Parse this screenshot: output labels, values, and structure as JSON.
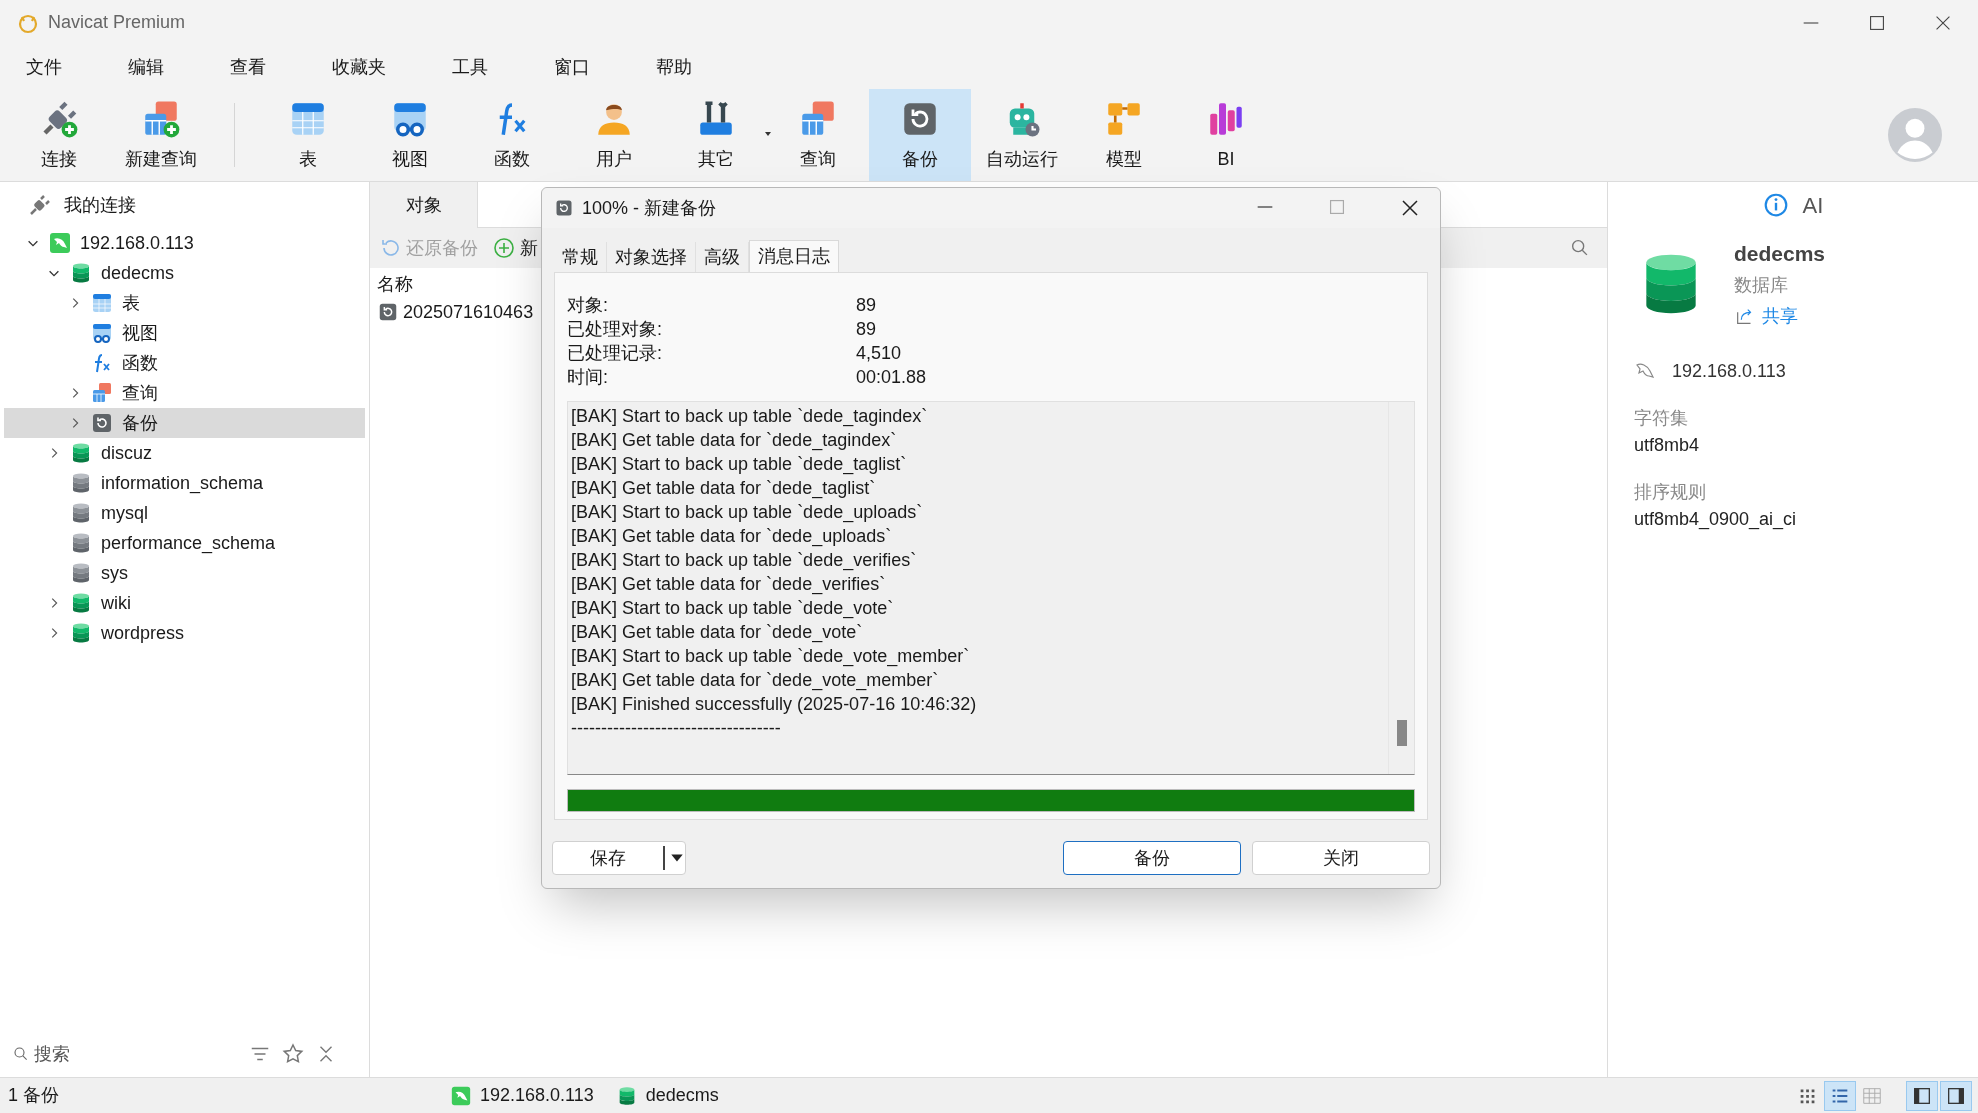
{
  "window": {
    "title": "Navicat Premium"
  },
  "menu": [
    "文件",
    "编辑",
    "查看",
    "收藏夹",
    "工具",
    "窗口",
    "帮助"
  ],
  "toolbar": [
    {
      "kind": "connect",
      "label": "连接",
      "selected": false,
      "dropdown": false
    },
    {
      "kind": "new_query",
      "label": "新建查询",
      "selected": false,
      "dropdown": false
    },
    {
      "kind": "table",
      "label": "表",
      "selected": false,
      "dropdown": false
    },
    {
      "kind": "view",
      "label": "视图",
      "selected": false,
      "dropdown": false
    },
    {
      "kind": "function",
      "label": "函数",
      "selected": false,
      "dropdown": false
    },
    {
      "kind": "user",
      "label": "用户",
      "selected": false,
      "dropdown": false
    },
    {
      "kind": "other",
      "label": "其它",
      "selected": false,
      "dropdown": true
    },
    {
      "kind": "query",
      "label": "查询",
      "selected": false,
      "dropdown": false
    },
    {
      "kind": "backup",
      "label": "备份",
      "selected": true,
      "dropdown": false
    },
    {
      "kind": "automation",
      "label": "自动运行",
      "selected": false,
      "dropdown": false
    },
    {
      "kind": "model",
      "label": "模型",
      "selected": false,
      "dropdown": false
    },
    {
      "kind": "bi",
      "label": "BI",
      "selected": false,
      "dropdown": false
    }
  ],
  "sidebar": {
    "header": "我的连接",
    "tree": [
      {
        "kind": "connection",
        "label": "192.168.0.113",
        "expandable": true,
        "expanded": true,
        "selected": false,
        "children": [
          {
            "kind": "db_open",
            "label": "dedecms",
            "expandable": true,
            "expanded": true,
            "selected": false,
            "children": [
              {
                "kind": "table",
                "label": "表",
                "expandable": true,
                "expanded": false,
                "selected": false
              },
              {
                "kind": "view",
                "label": "视图",
                "expandable": false,
                "expanded": false,
                "selected": false
              },
              {
                "kind": "function",
                "label": "函数",
                "expandable": false,
                "expanded": false,
                "selected": false
              },
              {
                "kind": "query",
                "label": "查询",
                "expandable": true,
                "expanded": false,
                "selected": false
              },
              {
                "kind": "backup",
                "label": "备份",
                "expandable": true,
                "expanded": false,
                "selected": true
              }
            ]
          },
          {
            "kind": "db_open",
            "label": "discuz",
            "expandable": true,
            "expanded": false,
            "selected": false
          },
          {
            "kind": "db_closed",
            "label": "information_schema",
            "expandable": false,
            "expanded": false,
            "selected": false
          },
          {
            "kind": "db_closed",
            "label": "mysql",
            "expandable": false,
            "expanded": false,
            "selected": false
          },
          {
            "kind": "db_closed",
            "label": "performance_schema",
            "expandable": false,
            "expanded": false,
            "selected": false
          },
          {
            "kind": "db_closed",
            "label": "sys",
            "expandable": false,
            "expanded": false,
            "selected": false
          },
          {
            "kind": "db_open",
            "label": "wiki",
            "expandable": true,
            "expanded": false,
            "selected": false
          },
          {
            "kind": "db_open",
            "label": "wordpress",
            "expandable": true,
            "expanded": false,
            "selected": false
          }
        ]
      }
    ],
    "search": {
      "placeholder": "搜索"
    }
  },
  "objects": {
    "tabs": [
      {
        "label": "对象",
        "selected": true
      }
    ],
    "actions": [
      {
        "kind": "restore",
        "label": "还原备份",
        "disabled": true
      },
      {
        "kind": "new",
        "label": "新",
        "disabled": false
      }
    ],
    "columns": [
      "名称"
    ],
    "rows": [
      "2025071610463"
    ]
  },
  "info": {
    "tabs": [
      {
        "kind": "info",
        "selected": true
      },
      {
        "kind": "ai",
        "label": "AI",
        "selected": false
      }
    ],
    "name": "dedecms",
    "type": "数据库",
    "share": "共享",
    "connection": "192.168.0.113",
    "fields": [
      {
        "label": "字符集",
        "value": "utf8mb4"
      },
      {
        "label": "排序规则",
        "value": "utf8mb4_0900_ai_ci"
      }
    ]
  },
  "dialog": {
    "title": "100% - 新建备份",
    "tabs": [
      {
        "label": "常规",
        "selected": false
      },
      {
        "label": "对象选择",
        "selected": false
      },
      {
        "label": "高级",
        "selected": false
      },
      {
        "label": "消息日志",
        "selected": true
      }
    ],
    "stats": [
      {
        "label": "对象:",
        "value": "89"
      },
      {
        "label": "已处理对象:",
        "value": "89"
      },
      {
        "label": "已处理记录:",
        "value": "4,510"
      },
      {
        "label": "时间:",
        "value": "00:01.88"
      }
    ],
    "log": [
      "[BAK] Start to back up table `dede_tagindex`",
      "[BAK] Get table data for `dede_tagindex`",
      "[BAK] Start to back up table `dede_taglist`",
      "[BAK] Get table data for `dede_taglist`",
      "[BAK] Start to back up table `dede_uploads`",
      "[BAK] Get table data for `dede_uploads`",
      "[BAK] Start to back up table `dede_verifies`",
      "[BAK] Get table data for `dede_verifies`",
      "[BAK] Start to back up table `dede_vote`",
      "[BAK] Get table data for `dede_vote`",
      "[BAK] Start to back up table `dede_vote_member`",
      "[BAK] Get table data for `dede_vote_member`",
      "[BAK] Finished successfully (2025-07-16 10:46:32)",
      "-----------------------------------"
    ],
    "progress": {
      "level": 1
    },
    "buttons": [
      {
        "kind": "split",
        "label": "保存"
      },
      {
        "kind": "default",
        "label": "备份"
      },
      {
        "kind": "normal",
        "label": "关闭"
      }
    ]
  },
  "status_bar": {
    "text": "1 备份",
    "connection": "192.168.0.113",
    "database": "dedecms",
    "view_modes": [
      {
        "kind": "grid",
        "selected": false
      },
      {
        "kind": "list",
        "selected": true
      },
      {
        "kind": "detail",
        "selected": false
      }
    ],
    "panels": [
      {
        "kind": "left",
        "selected": true
      },
      {
        "kind": "right",
        "selected": true
      }
    ]
  }
}
